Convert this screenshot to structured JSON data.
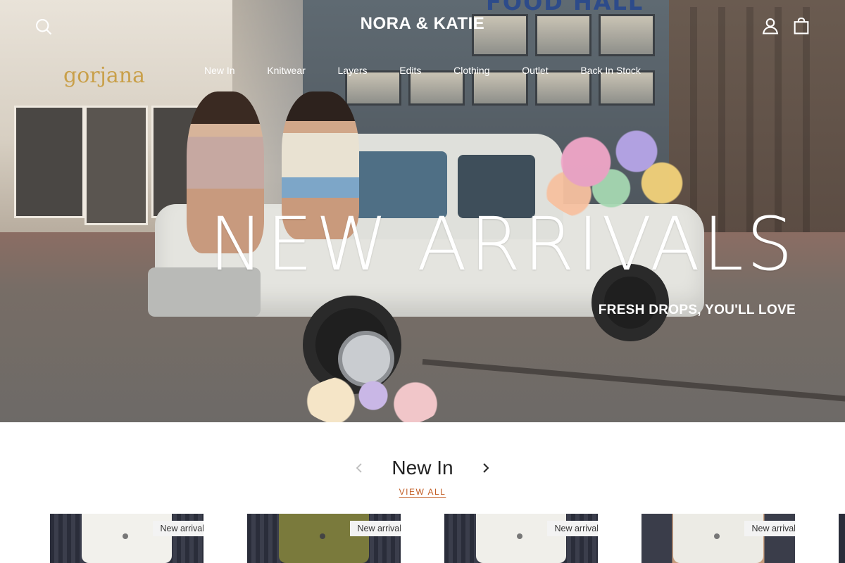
{
  "header": {
    "logo": "NORA & KATIE",
    "nav": [
      "New In",
      "Knitwear",
      "Layers",
      "Edits",
      "Clothing",
      "Outlet",
      "Back In Stock"
    ],
    "icons": {
      "search": "search-icon",
      "account": "user-icon",
      "cart": "bag-icon"
    }
  },
  "hero": {
    "title": "NEW ARRIVALS",
    "subtitle": "FRESH DROPS, YOU'LL LOVE",
    "backdrop_signs": {
      "left": "gorjana",
      "top": "FOOD HALL"
    }
  },
  "new_in": {
    "title": "New In",
    "view_all": "VIEW ALL",
    "products": [
      {
        "badge": "New arrival",
        "color": "#f2f1ec"
      },
      {
        "badge": "New arrival",
        "color": "#7a7a3c"
      },
      {
        "badge": "New arrival",
        "color": "#f0efea"
      },
      {
        "badge": "New arrival",
        "color": "#ecebe5"
      }
    ]
  },
  "colors": {
    "accent": "#c25b21",
    "text": "#222222",
    "badge_bg": "#f3f3f3"
  }
}
